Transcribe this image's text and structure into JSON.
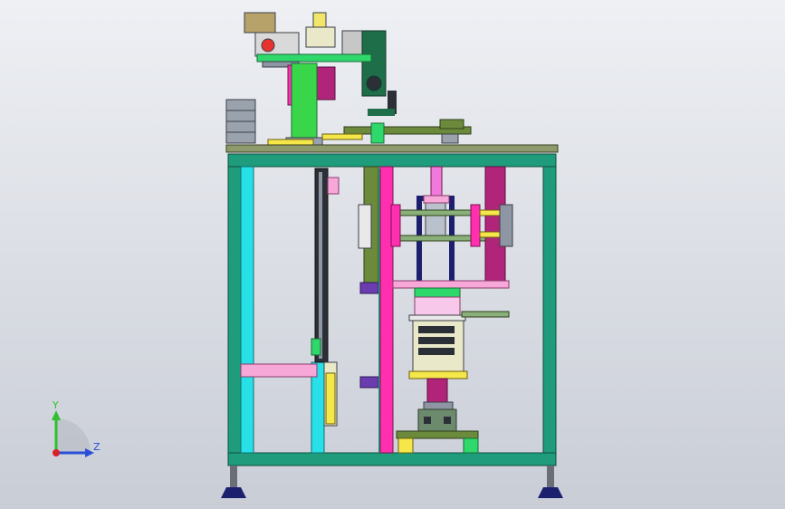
{
  "viewport": {
    "background_top": "#eef0f4",
    "background_bottom": "#c9cdd6"
  },
  "triad": {
    "y_label": "Y",
    "z_label": "Z",
    "y_color": "#2fbf2f",
    "z_color": "#2a4fd8",
    "x_color": "#d8202a"
  },
  "palette": {
    "frame_teal": "#1f9c7c",
    "frame_dark": "#0f6e56",
    "cyan": "#27e0e8",
    "magenta": "#ff2fb0",
    "olive": "#6c8a3c",
    "navy": "#1c1f6e",
    "pink": "#f7a8d8",
    "plum": "#b0247a",
    "gray": "#8e95a3",
    "green": "#2fd86a",
    "yellow": "#f5e64a",
    "dark": "#2b2f36"
  }
}
